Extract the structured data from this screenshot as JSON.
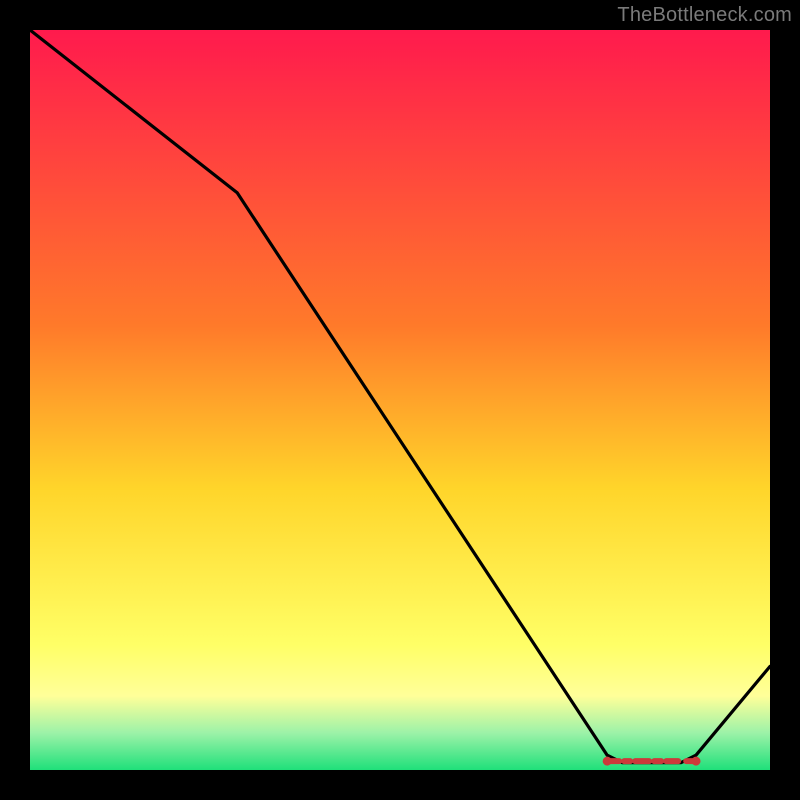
{
  "watermark": "TheBottleneck.com",
  "colors": {
    "bg": "#000000",
    "watermark": "#7a7a7a",
    "line": "#000000",
    "dash": "#cc3a3a",
    "grad_top": "#ff1a4d",
    "grad_mid1": "#ff7a2a",
    "grad_mid2": "#ffd52a",
    "grad_yellow_pale": "#ffff99",
    "grad_green_pale": "#9cf2a8",
    "grad_green": "#1fe07a"
  },
  "chart_data": {
    "type": "line",
    "title": "",
    "xlabel": "",
    "ylabel": "",
    "xlim": [
      0,
      100
    ],
    "ylim": [
      0,
      100
    ],
    "x": [
      0,
      28,
      78,
      80,
      88,
      90,
      100
    ],
    "values": [
      100,
      78,
      2,
      1,
      1,
      2,
      14
    ],
    "optimal_band": {
      "x_start": 78,
      "x_end": 90,
      "y": 1.2
    }
  }
}
